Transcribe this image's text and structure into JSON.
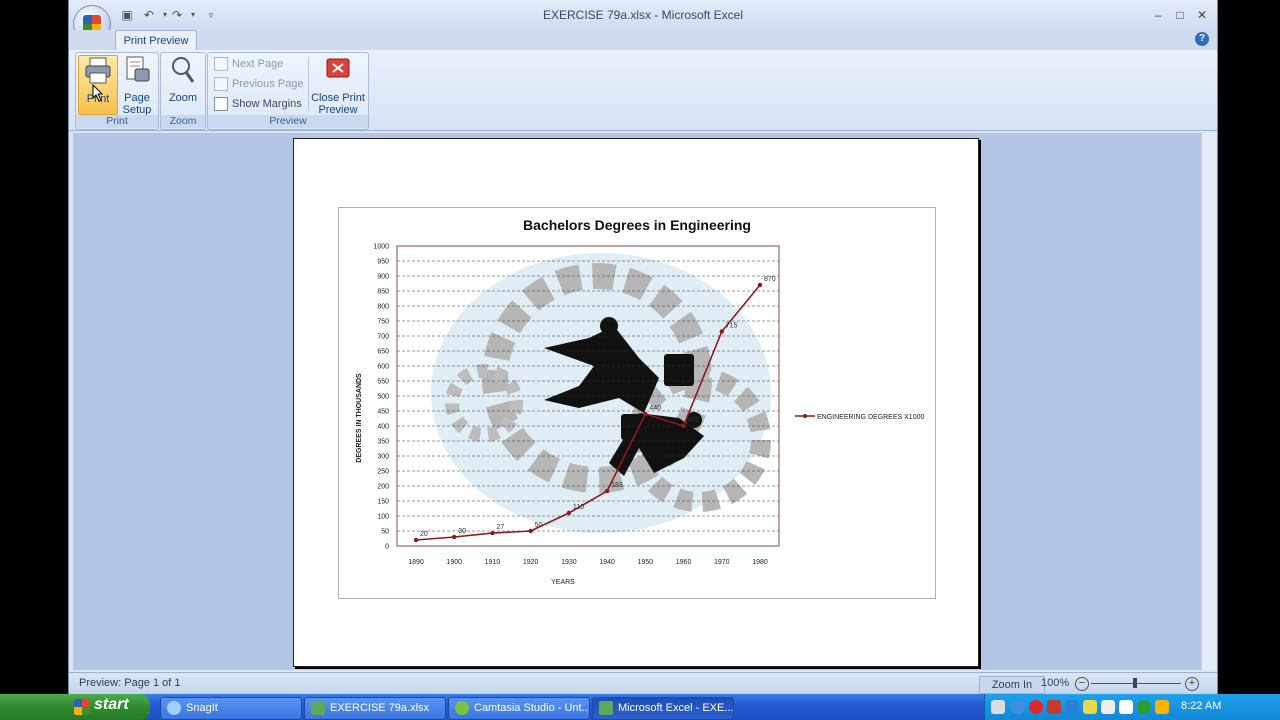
{
  "window": {
    "title": "EXERCISE 79a.xlsx - Microsoft Excel"
  },
  "ribbon": {
    "tab": "Print Preview",
    "groups": {
      "print": {
        "label": "Print",
        "print_btn": "Print",
        "page_setup_btn": [
          "Page",
          "Setup"
        ]
      },
      "zoom": {
        "label": "Zoom",
        "zoom_btn": "Zoom"
      },
      "preview": {
        "label": "Preview",
        "next_page": "Next Page",
        "previous_page": "Previous Page",
        "show_margins": "Show Margins",
        "close_btn": [
          "Close Print",
          "Preview"
        ]
      }
    }
  },
  "status": {
    "left": "Preview: Page 1 of 1",
    "zoom_in": "Zoom In",
    "zoom_pct": "100%"
  },
  "colors": {
    "series": "#8b1a1a",
    "ribbon_text": "#15428b"
  },
  "chart_data": {
    "type": "line",
    "title": "Bachelors Degrees in Engineering",
    "xlabel": "YEARS",
    "ylabel": "DEGREES IN THOUSANDS",
    "ylim": [
      0,
      1000
    ],
    "yticks": [
      "0",
      "50",
      "100",
      "150",
      "200",
      "250",
      "300",
      "350",
      "400",
      "450",
      "500",
      "550",
      "600",
      "650",
      "700",
      "750",
      "800",
      "850",
      "900",
      "950",
      "1000"
    ],
    "categories": [
      "1890",
      "1900",
      "1910",
      "1920",
      "1930",
      "1940",
      "1950",
      "1960",
      "1970",
      "1980"
    ],
    "series": [
      {
        "name": "ENGINEERING DEGREES X1000",
        "values": [
          20,
          30,
          43,
          50,
          110,
          183,
          440,
          400,
          715,
          870
        ],
        "labels": [
          "20",
          "30",
          "27",
          "50",
          "110",
          "183",
          "440",
          "400",
          "715",
          "870"
        ]
      }
    ],
    "grid": true,
    "legend": "right"
  },
  "taskbar": {
    "start": "start",
    "tasks": [
      "SnagIt",
      "EXERCISE 79a.xlsx",
      "Camtasia Studio - Unt...",
      "Microsoft Excel - EXE..."
    ],
    "clock": "8:22 AM"
  }
}
